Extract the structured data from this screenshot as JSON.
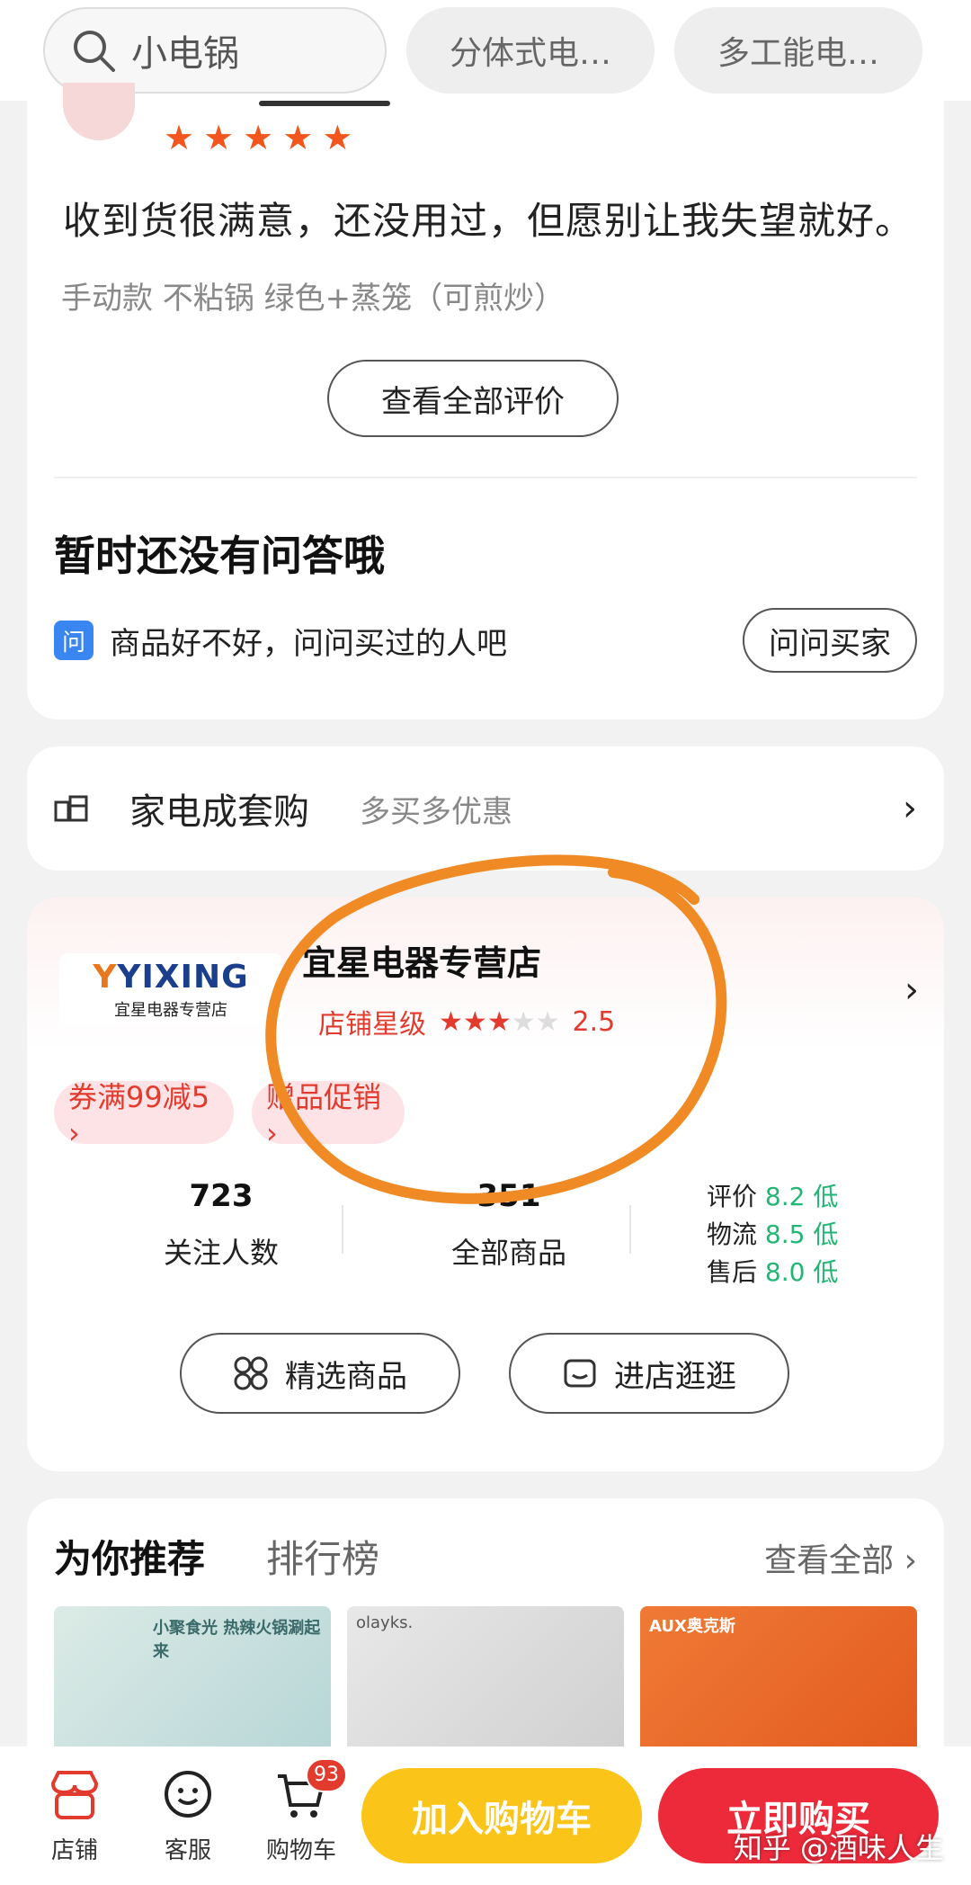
{
  "search": {
    "value": "小电锅"
  },
  "chips": [
    "分体式电…",
    "多工能电…"
  ],
  "review": {
    "text": "收到货很满意，还没用过，但愿别让我失望就好。",
    "spec": "手动款 不粘锅 绿色+蒸笼（可煎炒）",
    "all_reviews_label": "查看全部评价",
    "rating": 5
  },
  "qa": {
    "title": "暂时还没有问答哦",
    "icon_text": "问",
    "prompt": "商品好不好，问问买过的人吧",
    "ask_label": "问问买家"
  },
  "bundle": {
    "title": "家电成套购",
    "subtitle": "多买多优惠"
  },
  "store": {
    "logo_brand": "YIXING",
    "logo_sub": "宜星电器专营店",
    "name": "宜星电器专营店",
    "rating_label": "店铺星级",
    "rating_value": "2.5",
    "promos": [
      "券满99减5 ›",
      "赠品促销 ›"
    ],
    "followers": {
      "value": "723",
      "label": "关注人数"
    },
    "products": {
      "value": "351",
      "label": "全部商品"
    },
    "scores": [
      {
        "label": "评价",
        "value": "8.2",
        "level": "低"
      },
      {
        "label": "物流",
        "value": "8.5",
        "level": "低"
      },
      {
        "label": "售后",
        "value": "8.0",
        "level": "低"
      }
    ],
    "btn_featured": "精选商品",
    "btn_visit": "进店逛逛"
  },
  "recommend": {
    "tab_active": "为你推荐",
    "tab_other": "排行榜",
    "see_all": "查看全部 ›",
    "thumbs": [
      "小聚食光 热辣火锅涮起来",
      "olayks.",
      "AUX奥克斯"
    ]
  },
  "bottom": {
    "store": "店铺",
    "service": "客服",
    "cart": "购物车",
    "cart_count": "93",
    "add_cart": "加入购物车",
    "buy_now": "立即购买",
    "watermark": "知乎 @酒味人生"
  },
  "colors": {
    "accent_red": "#e23b2e",
    "cart_yellow": "#fbc418",
    "buy_red": "#ec2a3a",
    "score_green": "#22b573",
    "annotation_orange": "#f08a24"
  }
}
